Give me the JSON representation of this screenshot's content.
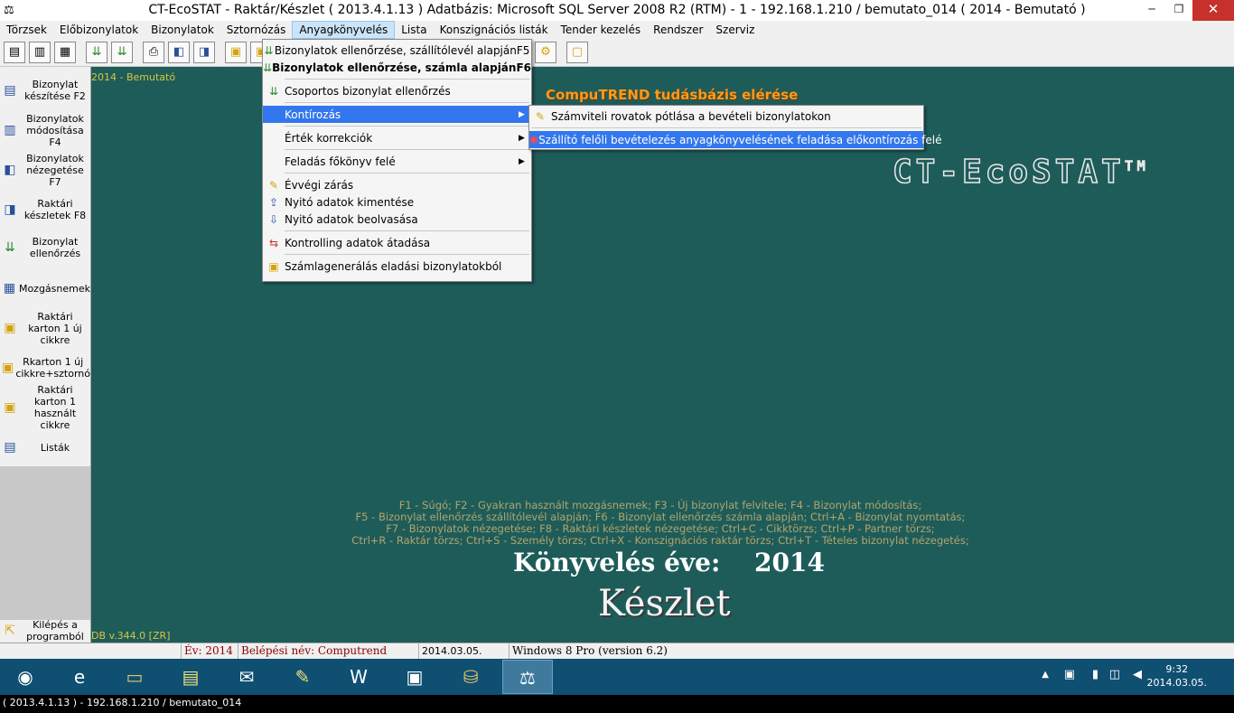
{
  "window": {
    "title": "CT-EcoSTAT - Raktár/Készlet ( 2013.4.1.13 ) Adatbázis: Microsoft SQL Server 2008 R2 (RTM) - 1 - 192.168.1.210 / bemutato_014  ( 2014 - Bemutató )",
    "minimize": "─",
    "maximize": "❐",
    "close": "✕"
  },
  "menubar": [
    "Törzsek",
    "Előbizonylatok",
    "Bizonylatok",
    "Sztornózás",
    "Anyagkönyvelés",
    "Lista",
    "Konszignációs listák",
    "Tender kezelés",
    "Rendszer",
    "Szerviz"
  ],
  "sidebar": {
    "items": [
      {
        "label": "Bizonylat készítése F2",
        "icon": "document-icon"
      },
      {
        "label": "Bizonylatok módosítása F4",
        "icon": "document-edit-icon"
      },
      {
        "label": "Bizonylatok nézegetése F7",
        "icon": "document-view-icon"
      },
      {
        "label": "Raktári készletek F8",
        "icon": "stock-icon"
      },
      {
        "label": "Bizonylat ellenőrzés",
        "icon": "check-icon"
      },
      {
        "label": "Mozgásnemek",
        "icon": "grid-icon"
      },
      {
        "label": "Raktári karton 1 új cikkre",
        "icon": "card-icon"
      },
      {
        "label": "Rkarton 1 új cikkre+sztornó",
        "icon": "card-icon"
      },
      {
        "label": "Raktári karton 1 használt cikkre",
        "icon": "card-icon"
      },
      {
        "label": "Listák",
        "icon": "list-icon"
      },
      {
        "label": "Kilépés a programból",
        "icon": "exit-icon"
      }
    ]
  },
  "main": {
    "year_tag": "2014 - Bemutató",
    "kb_link": "CompuTREND tudásbázis elérése",
    "logo": "CT-EcoSTAT",
    "logo_tm": "TM",
    "help_lines": [
      "F1 - Súgó; F2 - Gyakran használt mozgásnemek; F3 - Új bizonylat felvitele; F4 - Bizonylat módosítás;",
      "F5 - Bizonylat ellenőrzés szállítólevél alapján; F6 - Bizonylat ellenőrzés számla alapján;  Ctrl+A - Bizonylat nyomtatás;",
      "F7 - Bizonylatok nézegetése; F8 - Raktári készletek nézegetése; Ctrl+C - Cikktörzs; Ctrl+P - Partner törzs;",
      "Ctrl+R - Raktár törzs; Ctrl+S - Személy törzs; Ctrl+X - Konszignációs raktár törzs; Ctrl+T - Tételes bizonylat nézegetés;"
    ],
    "year_label": "Könyvelés éve:",
    "year_value": "2014",
    "module": "Készlet",
    "db_version": "DB v.344.0 [ZR]"
  },
  "statusbar": {
    "year": "Év: 2014",
    "login": "Belépési név: Computrend",
    "date": "2014.03.05.",
    "os": "Windows 8 Pro (version 6.2)"
  },
  "menu": {
    "items": [
      {
        "label": "Bizonylatok ellenőrzése, szállítólevél alapján",
        "shortcut": "F5"
      },
      {
        "label": "Bizonylatok ellenőrzése, számla alapján",
        "shortcut": "F6"
      },
      {
        "label": "Csoportos bizonylat ellenőrzés"
      },
      {
        "label": "Kontírozás"
      },
      {
        "label": "Érték korrekciók"
      },
      {
        "label": "Feladás főkönyv felé"
      },
      {
        "label": "Évvégi zárás"
      },
      {
        "label": "Nyitó adatok kimentése"
      },
      {
        "label": "Nyitó adatok beolvasása"
      },
      {
        "label": "Kontrolling adatok átadása"
      },
      {
        "label": "Számlagenerálás eladási bizonylatokból"
      }
    ]
  },
  "submenu": {
    "items": [
      {
        "label": "Számviteli rovatok pótlása a bevételi bizonylatokon"
      },
      {
        "label": "Szállító felőli bevételezés anyagkönyvelésének feladása előkontírozás felé"
      }
    ]
  },
  "taskbar": {
    "clock_time": "9:32",
    "clock_date": "2014.03.05."
  },
  "bottom_status": "( 2013.4.1.13 ) - 192.168.1.210 / bemutato_014"
}
